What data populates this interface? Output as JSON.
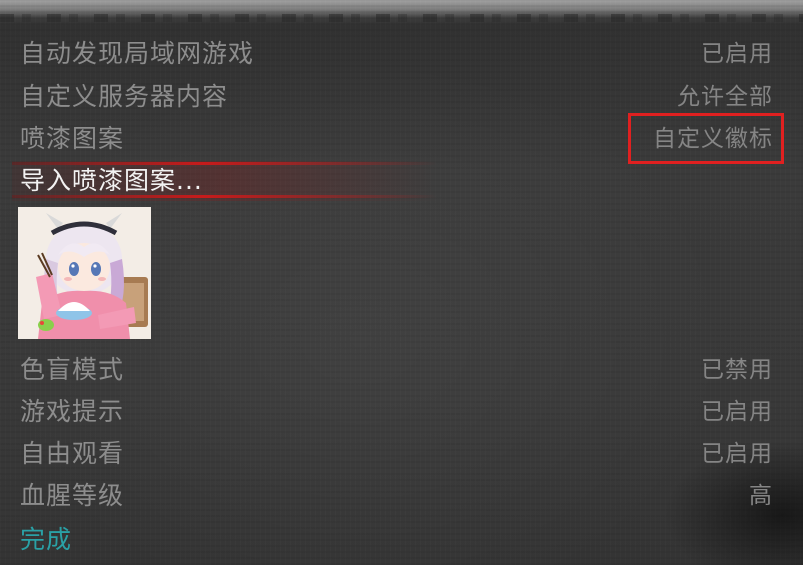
{
  "settings": [
    {
      "label": "自动发现局域网游戏",
      "value": "已启用"
    },
    {
      "label": "自定义服务器内容",
      "value": "允许全部"
    },
    {
      "label": "喷漆图案",
      "value": "自定义徽标"
    },
    {
      "label": "导入喷漆图案...",
      "value": ""
    }
  ],
  "settings2": [
    {
      "label": "色盲模式",
      "value": "已禁用"
    },
    {
      "label": "游戏提示",
      "value": "已启用"
    },
    {
      "label": "自由观看",
      "value": "已启用"
    },
    {
      "label": "血腥等级",
      "value": "高"
    }
  ],
  "done_label": "完成",
  "colors": {
    "accent_red": "#c61b1b",
    "callout_red": "#e02020",
    "done_teal": "#2aa1a6"
  }
}
